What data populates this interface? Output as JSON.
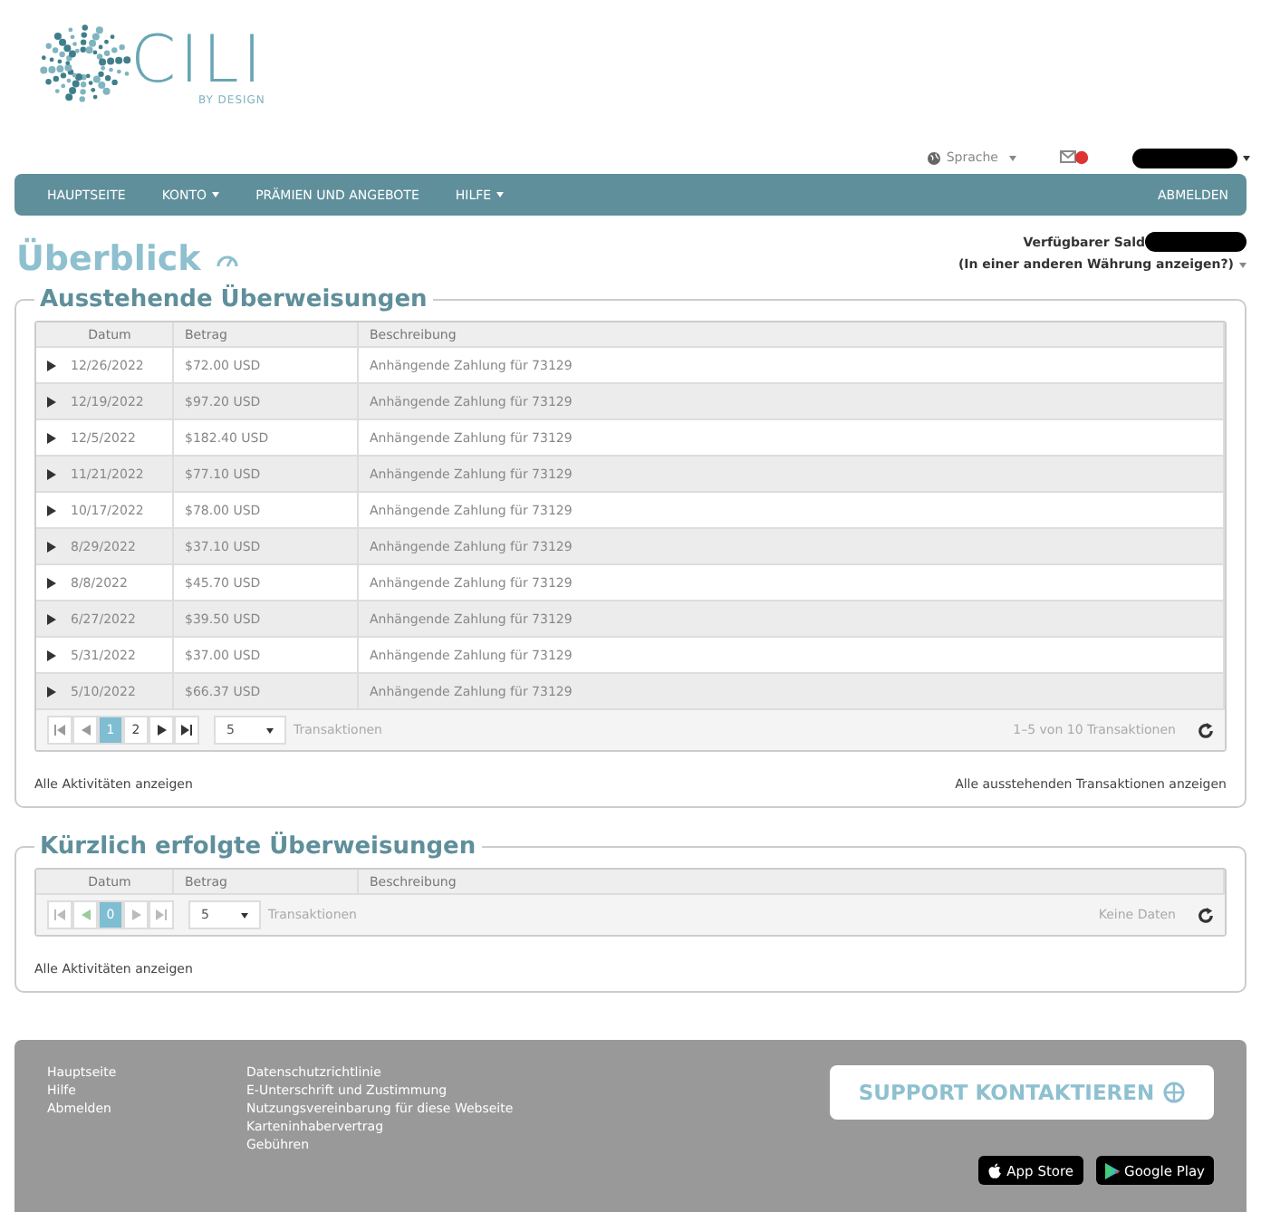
{
  "logo": {
    "name": "CILI",
    "tagline": "BY DESIGN"
  },
  "utility": {
    "language": "Sprache",
    "mail_badge": true
  },
  "nav": {
    "items": [
      {
        "label": "HAUPTSEITE",
        "dropdown": false
      },
      {
        "label": "KONTO",
        "dropdown": true
      },
      {
        "label": "PRÄMIEN UND ANGEBOTE",
        "dropdown": false
      },
      {
        "label": "HILFE",
        "dropdown": true
      }
    ],
    "logout": "ABMELDEN"
  },
  "page": {
    "title": "Überblick",
    "balance_label": "Verfügbarer Sald",
    "currency_link": "(In einer anderen Währung anzeigen?)"
  },
  "sections": [
    {
      "title": "Ausstehende Überweisungen",
      "columns": [
        "Datum",
        "Betrag",
        "Beschreibung"
      ],
      "rows": [
        {
          "date": "12/26/2022",
          "amount": "$72.00 USD",
          "description": "Anhängende Zahlung für 73129"
        },
        {
          "date": "12/19/2022",
          "amount": "$97.20 USD",
          "description": "Anhängende Zahlung für 73129"
        },
        {
          "date": "12/5/2022",
          "amount": "$182.40 USD",
          "description": "Anhängende Zahlung für 73129"
        },
        {
          "date": "11/21/2022",
          "amount": "$77.10 USD",
          "description": "Anhängende Zahlung für 73129"
        },
        {
          "date": "10/17/2022",
          "amount": "$78.00 USD",
          "description": "Anhängende Zahlung für 73129"
        },
        {
          "date": "8/29/2022",
          "amount": "$37.10 USD",
          "description": "Anhängende Zahlung für 73129"
        },
        {
          "date": "8/8/2022",
          "amount": "$45.70 USD",
          "description": "Anhängende Zahlung für 73129"
        },
        {
          "date": "6/27/2022",
          "amount": "$39.50 USD",
          "description": "Anhängende Zahlung für 73129"
        },
        {
          "date": "5/31/2022",
          "amount": "$37.00 USD",
          "description": "Anhängende Zahlung für 73129"
        },
        {
          "date": "5/10/2022",
          "amount": "$66.37 USD",
          "description": "Anhängende Zahlung für 73129"
        }
      ],
      "pager": {
        "nav_disabled": false,
        "pages": [
          {
            "label": "1",
            "selected": true
          },
          {
            "label": "2",
            "selected": false
          }
        ],
        "page_size": "5",
        "size_label": "Transaktionen",
        "info": "1–5 von 10 Transaktionen"
      },
      "links": [
        "Alle Aktivitäten anzeigen",
        "Alle ausstehenden Transaktionen anzeigen"
      ]
    },
    {
      "title": "Kürzlich erfolgte Überweisungen",
      "columns": [
        "Datum",
        "Betrag",
        "Beschreibung"
      ],
      "pager": {
        "nav_disabled": true,
        "pages": [
          {
            "label": "0",
            "selected": true
          }
        ],
        "page_size": "5",
        "size_label": "Transaktionen",
        "info": "Keine Daten"
      },
      "links": [
        "Alle Aktivitäten anzeigen"
      ]
    }
  ],
  "footer": {
    "column_1": [
      "Hauptseite",
      "Hilfe",
      "Abmelden"
    ],
    "column_2": [
      "Datenschutzrichtlinie",
      "E-Unterschrift und Zustimmung",
      "Nutzungsvereinbarung für diese Webseite",
      "Karteninhabervertrag",
      "Gebühren"
    ],
    "support": "SUPPORT KONTAKTIEREN",
    "stores": [
      {
        "kind": "apple",
        "label": "App Store"
      },
      {
        "kind": "google",
        "label": "Google Play"
      }
    ]
  }
}
